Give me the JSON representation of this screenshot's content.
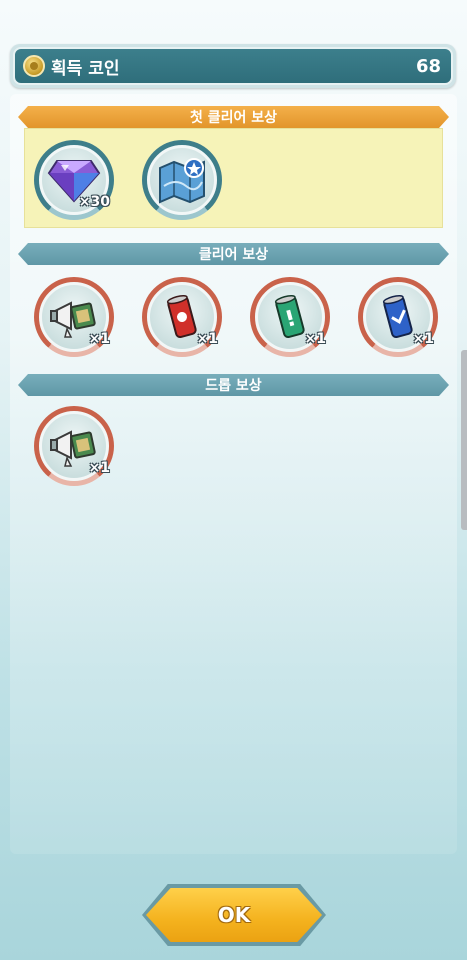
{
  "coin_bar": {
    "label": "획득 코인",
    "value": "68"
  },
  "sections": {
    "first_clear": {
      "title": "첫 클리어 보상",
      "items": [
        {
          "icon": "crystal-icon",
          "qty": "×30"
        },
        {
          "icon": "map-icon",
          "qty": ""
        }
      ]
    },
    "clear": {
      "title": "클리어 보상",
      "items": [
        {
          "icon": "megaphone-ticket-icon",
          "qty": "×1"
        },
        {
          "icon": "red-can-icon",
          "qty": "×1"
        },
        {
          "icon": "green-can-icon",
          "qty": "×1"
        },
        {
          "icon": "blue-can-icon",
          "qty": "×1"
        }
      ]
    },
    "drop": {
      "title": "드롭 보상",
      "items": [
        {
          "icon": "megaphone-ticket-icon",
          "qty": "×1"
        }
      ]
    }
  },
  "ok_button": {
    "label": "OK"
  },
  "colors": {
    "accent_orange": "#e2952b",
    "header_teal": "#5f97a6",
    "ok_yellow": "#f4b21e"
  }
}
